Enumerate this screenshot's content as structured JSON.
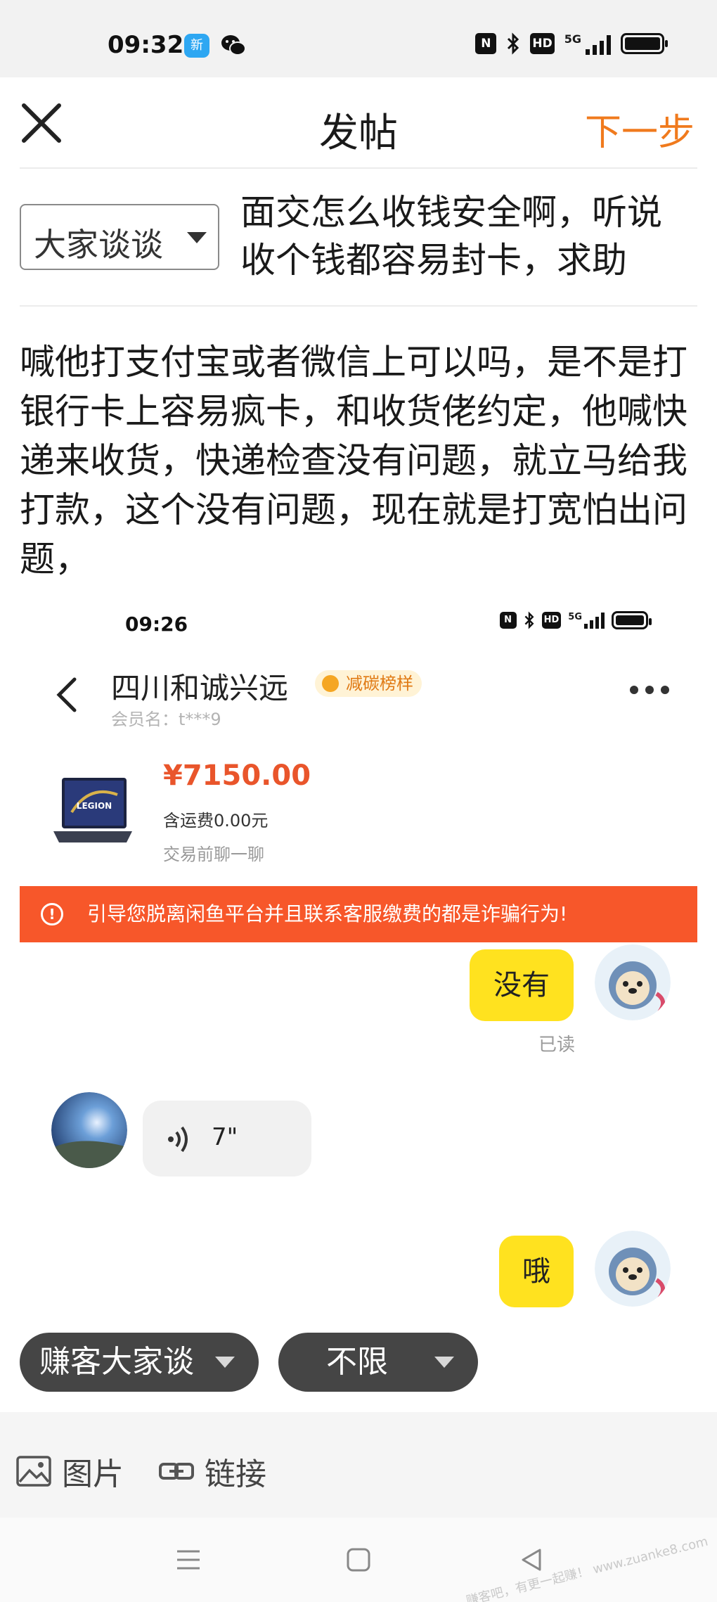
{
  "status_bar": {
    "time": "09:32",
    "badge_text": "新",
    "hd_label": "HD",
    "network_label": "5G"
  },
  "header": {
    "title": "发帖",
    "next_label": "下一步"
  },
  "category": {
    "selected": "大家谈谈"
  },
  "post": {
    "title": "面交怎么收钱安全啊，听说收个钱都容易封卡，求助",
    "body": "喊他打支付宝或者微信上可以吗，是不是打银行卡上容易疯卡，和收货佬约定，他喊快递来收货，快递检查没有问题，就立马给我打款，这个没有问题，现在就是打宽怕出问题，"
  },
  "embedded_screenshot": {
    "time": "09:26",
    "hd_label": "HD",
    "network_label": "5G",
    "shop_name": "四川和诚兴远",
    "shop_tag": "减碳榜样",
    "member": "会员名：t***9",
    "product_logo": "LEGION",
    "price": "¥7150.00",
    "shipping": "含运费0.00元",
    "chat_before": "交易前聊一聊",
    "warning": "引导您脱离闲鱼平台并且联系客服缴费的都是诈骗行为!",
    "warning_icon": "!",
    "messages": {
      "sent_1": "没有",
      "read_status": "已读",
      "voice_duration": "7\"",
      "sent_2": "哦"
    }
  },
  "chips": {
    "board": "赚客大家谈",
    "limit": "不限"
  },
  "toolbar": {
    "image_label": "图片",
    "link_label": "链接"
  },
  "watermark": "赚客吧，有更一起赚！ www.zuanke8.com",
  "colors": {
    "accent_orange": "#f07a1d",
    "price_red": "#e9552b",
    "warning_bar": "#f7572a",
    "chat_bubble": "#ffe21f",
    "chip_bg": "#454545"
  },
  "icons": [
    "close-icon",
    "caret-down-icon",
    "back-chevron-icon",
    "more-icon",
    "voice-icon",
    "warning-icon",
    "image-icon",
    "link-icon",
    "menu-icon",
    "home-icon",
    "back-icon"
  ]
}
